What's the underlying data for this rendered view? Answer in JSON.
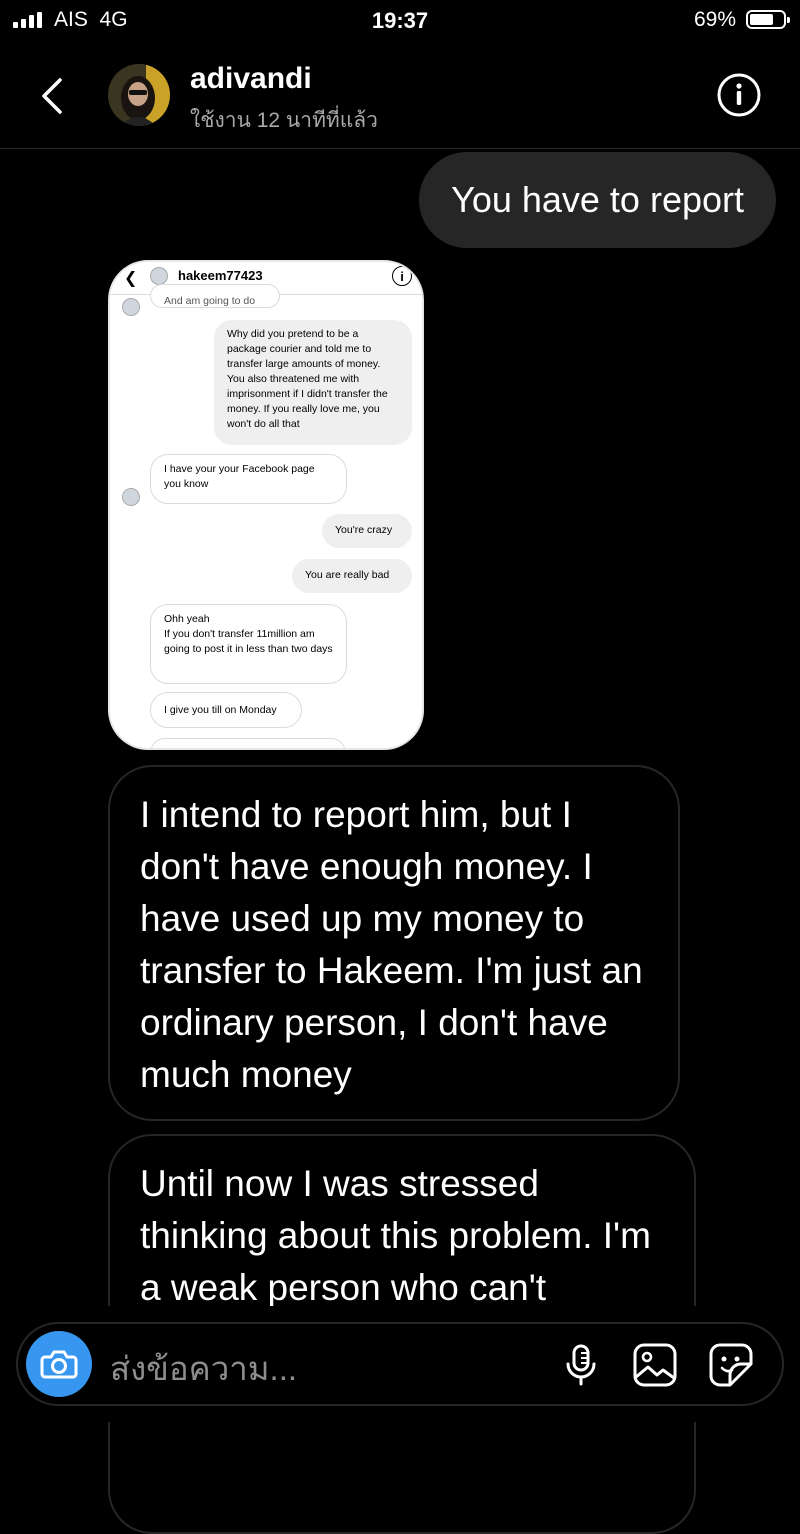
{
  "status_bar": {
    "carrier": "AIS",
    "network": "4G",
    "time": "19:37",
    "battery": "69%",
    "battery_level": 0.69
  },
  "header": {
    "username": "adivandi",
    "active_status": "ใช้งาน 12 นาทีที่แล้ว"
  },
  "messages": {
    "outgoing_1": "You have to report",
    "incoming_1": "I intend to report him, but I don't have enough money. I have used up my money to transfer to Hakeem. I'm just an ordinary person, I don't have much money",
    "incoming_2": "Until now I was stressed thinking about this problem. I'm a weak person who can't"
  },
  "shared_screenshot": {
    "username": "hakeem77423",
    "partial_top": "And am going to do",
    "msg1": "Why did you pretend to be a package courier and told me to transfer large amounts of money. You also threatened me with imprisonment if I didn't transfer the money. If you really love me, you won't do all that",
    "msg2": "I have your your Facebook page you know",
    "msg3": "You're crazy",
    "msg4": "You are really bad",
    "msg5": "Ohh yeah\nIf you don't transfer 11million am going to post it in less than two days",
    "msg6": "I give you till on Monday"
  },
  "composer": {
    "placeholder": "ส่งข้อความ..."
  },
  "icons": [
    "back-icon",
    "info-icon",
    "camera-icon",
    "microphone-icon",
    "gallery-icon",
    "sticker-icon"
  ]
}
